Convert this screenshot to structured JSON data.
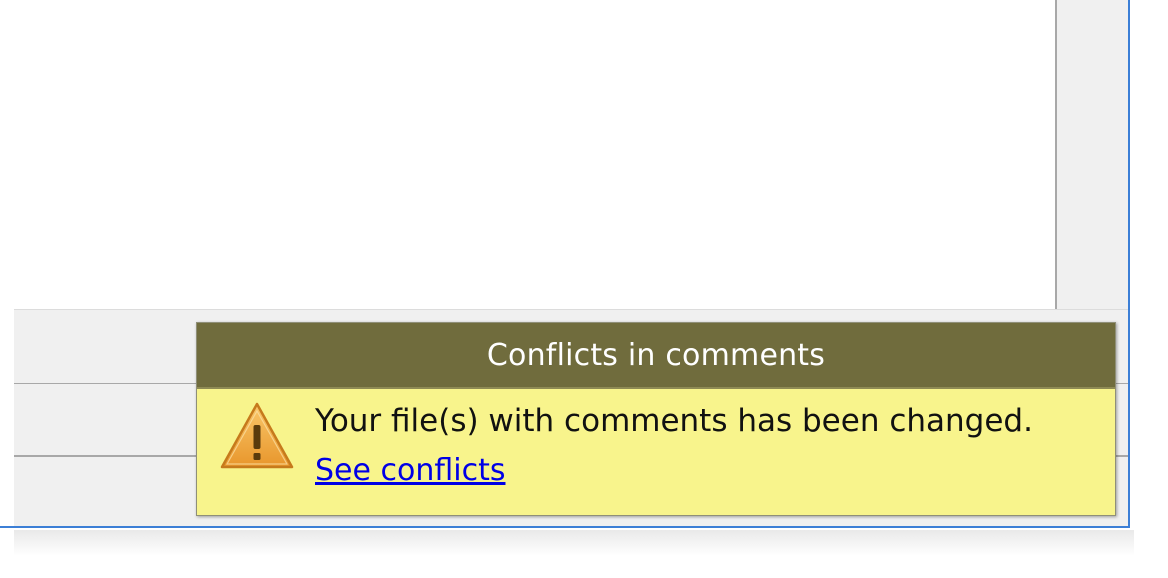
{
  "notification": {
    "title": "Conflicts in comments",
    "message": "Your file(s) with comments has been changed.",
    "link_text": "See conflicts",
    "icon": "warning-icon"
  },
  "colors": {
    "header_bg": "#706c3d",
    "body_bg": "#f8f48c",
    "link": "#0000e6",
    "window_accent": "#3c7fd6"
  }
}
